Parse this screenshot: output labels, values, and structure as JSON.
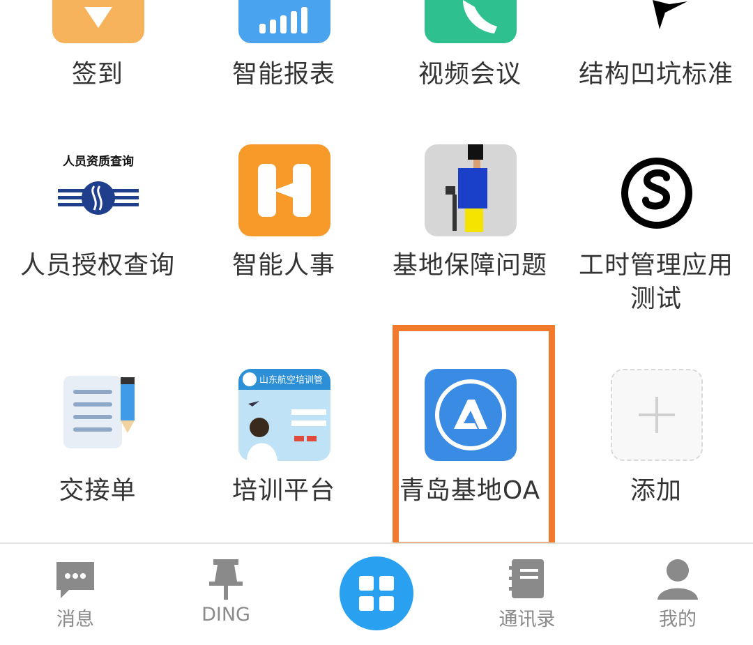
{
  "apps": [
    {
      "label": "签到",
      "icon": "location-check-icon",
      "color": "#f7b25c"
    },
    {
      "label": "智能报表",
      "icon": "signal-bars-icon",
      "color": "#4aa3ee"
    },
    {
      "label": "视频会议",
      "icon": "phone-icon",
      "color": "#2ec18f"
    },
    {
      "label": "结构凹坑标准",
      "icon": "bird-icon",
      "color": "#000000"
    },
    {
      "label": "人员授权查询",
      "icon": "personnel-logo-icon",
      "caption": "人员资质查询",
      "color": "#1f3f8c"
    },
    {
      "label": "智能人事",
      "icon": "h-logo-icon",
      "color": "#f79a2a"
    },
    {
      "label": "基地保障问题",
      "icon": "pixel-person-icon",
      "color": "#d6d6d6"
    },
    {
      "label": "工时管理应用",
      "label2": "测试",
      "icon": "circle-s-icon",
      "color": "#000000"
    },
    {
      "label": "交接单",
      "icon": "document-pencil-icon",
      "color": "#6fa8e8"
    },
    {
      "label": "培训平台",
      "icon": "training-banner-icon",
      "banner": "山东航空培训管",
      "color": "#2d8fd6"
    },
    {
      "label": "青岛基地OA",
      "icon": "oa-logo-icon",
      "color": "#3a8be4"
    },
    {
      "label": "添加",
      "icon": "plus-icon",
      "color": "#d8d8d8"
    }
  ],
  "tabs": [
    {
      "label": "消息",
      "icon": "chat-bubble-icon"
    },
    {
      "label": "DING",
      "icon": "pin-icon"
    },
    {
      "label": "",
      "icon": "grid-apps-icon"
    },
    {
      "label": "通讯录",
      "icon": "contacts-book-icon"
    },
    {
      "label": "我的",
      "icon": "person-icon"
    }
  ],
  "colors": {
    "highlight": "#f27a2c",
    "active_tab": "#2aa0f0",
    "tab_text": "#8a8a8a"
  }
}
